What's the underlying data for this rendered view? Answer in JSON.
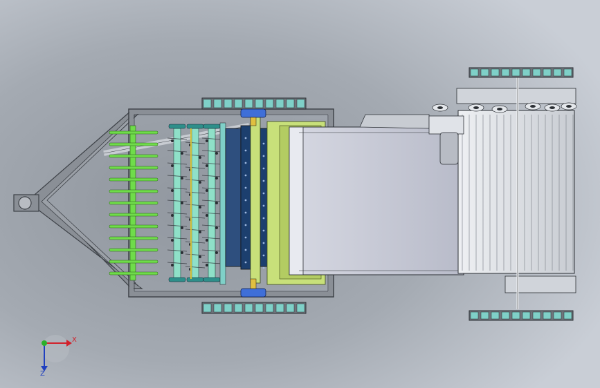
{
  "viewport": {
    "background_colors": [
      "#c9ced6",
      "#8e949c",
      "#bfc5cd"
    ]
  },
  "axis_triad": {
    "x_label": "X",
    "z_label": "Z",
    "x_color": "#d2202a",
    "z_color": "#1f3fbf",
    "y_color": "#2bb02b"
  },
  "colors": {
    "frame": "#8a8f96",
    "frame_dark": "#3c4046",
    "tine": "#6fdc4a",
    "rotor": "#8fe0c8",
    "chain": "#7fd0c8",
    "roller_dark": "#1c3f6e",
    "panel_green": "#c8e07a",
    "belt": "#c9ccd8",
    "housing": "#d9dde2",
    "bearing": "#3f6fd8"
  }
}
